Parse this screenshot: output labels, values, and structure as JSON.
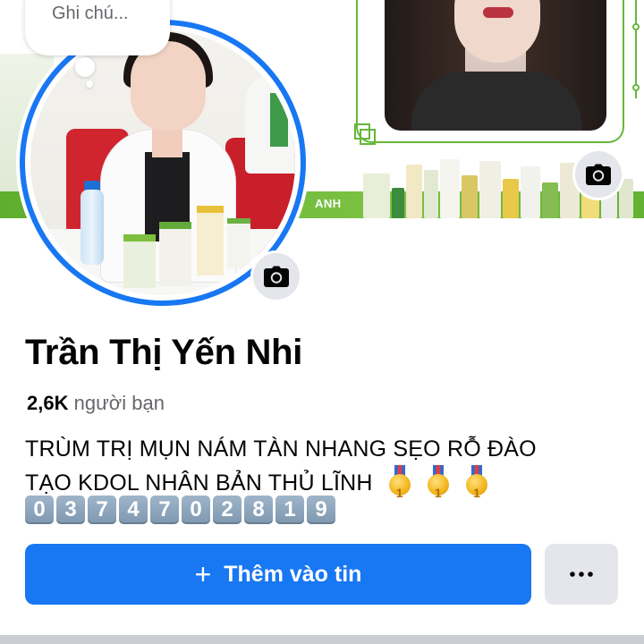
{
  "profile": {
    "note_placeholder": "Ghi chú...",
    "name": "Trần Thị Yến Nhi",
    "friends_count": "2,6K",
    "friends_label": "người bạn",
    "bio_line1": "TRÙM TRỊ MỤN NÁM TÀN NHANG SẸO RỖ ĐÀO",
    "bio_line2": "TẠO KDOL NHÂN BẢN THỦ LĨNH",
    "medal_digit": "1",
    "phone_digits": [
      "0",
      "3",
      "7",
      "4",
      "7",
      "0",
      "2",
      "8",
      "1",
      "9"
    ]
  },
  "cover": {
    "banner_text": "ANH",
    "accent_color": "#66b73a"
  },
  "actions": {
    "add_story_label": "Thêm vào tin",
    "add_story_icon": "plus-icon",
    "more_icon": "more-dots-icon",
    "primary_color": "#1877f2"
  },
  "icons": {
    "avatar_camera": "camera-icon",
    "cover_camera": "camera-icon"
  }
}
